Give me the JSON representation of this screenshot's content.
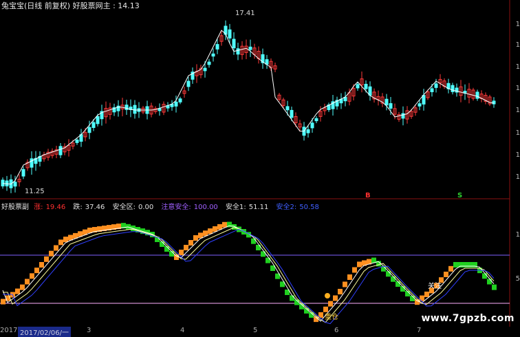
{
  "header": {
    "title": "兔宝宝(日线 前复权) 好股票网主 : 14.13"
  },
  "price_panel": {
    "high_label": "17.41",
    "low_label": "11.25",
    "signals": [
      {
        "text": "B",
        "color": "#ff3030"
      },
      {
        "text": "S",
        "color": "#30d030"
      }
    ],
    "axis_ticks": [
      "1",
      "1",
      "1",
      "1",
      "1",
      "1",
      "1",
      "1"
    ]
  },
  "indicator_panel": {
    "name": "好股票副",
    "items": [
      {
        "label": "涨:",
        "value": "19.46",
        "color": "#ff3030"
      },
      {
        "label": "跌:",
        "value": "37.46",
        "color": "#e0e0e0"
      },
      {
        "label": "安全区:",
        "value": "0.00",
        "color": "#e0e0e0"
      },
      {
        "label": "注意安全:",
        "value": "100.00",
        "color": "#a060ff"
      },
      {
        "label": "安全1:",
        "value": "51.11",
        "color": "#e0e0e0"
      },
      {
        "label": "安全2:",
        "value": "50.58",
        "color": "#4040ff"
      }
    ],
    "markers": [
      "重仓",
      "关注"
    ],
    "axis_ticks": [
      "1",
      "5"
    ]
  },
  "bottom_axis": {
    "left_text": "20173",
    "date_box": "2017/02/06/一",
    "months": [
      "3",
      "4",
      "5",
      "6",
      "7"
    ]
  },
  "watermark": "www.7gpzb.com",
  "colors": {
    "up_candle": "#ff3a3a",
    "down_candle": "#50ffff",
    "ma_line": "#ffffff",
    "orange_bar": "#ff9020",
    "green_bar": "#20d020",
    "purple_line": "#8060ff",
    "pink_line": "#ffb0ff"
  }
}
